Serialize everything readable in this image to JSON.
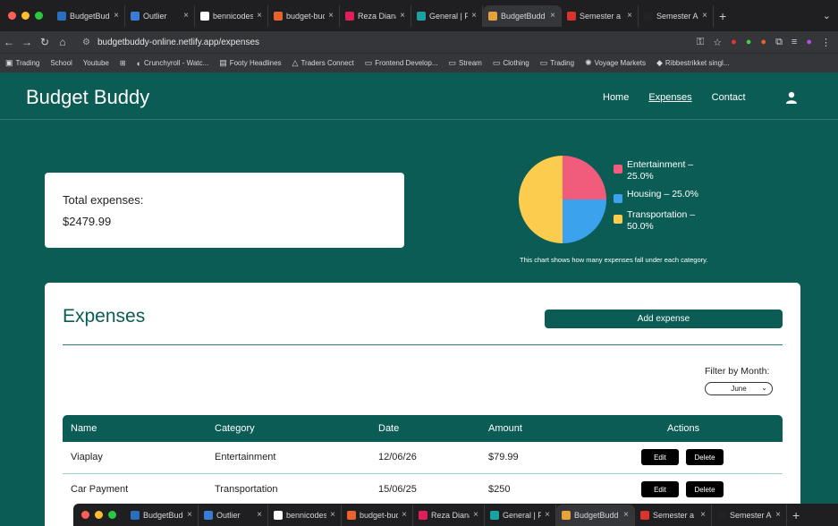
{
  "browser": {
    "tabs": [
      {
        "title": "BudgetBudd",
        "color": "#2a6ebf"
      },
      {
        "title": "Outlier",
        "color": "#3a7bd5"
      },
      {
        "title": "bennicodes",
        "color": "#ffffff"
      },
      {
        "title": "budget-bud",
        "color": "#e8632c"
      },
      {
        "title": "Reza Dianat",
        "color": "#e01e5a"
      },
      {
        "title": "General | P",
        "color": "#1aa1a1"
      },
      {
        "title": "BudgetBudd",
        "color": "#e6a23c",
        "active": true
      },
      {
        "title": "Semester a",
        "color": "#d9342b"
      },
      {
        "title": "Semester A",
        "color": "#222222"
      }
    ],
    "url": "budgetbuddy-online.netlify.app/expenses",
    "bookmarks": [
      "Trading",
      "School",
      "Youtube",
      "Crunchyroll - Watc...",
      "Footy Headlines",
      "Traders Connect",
      "Frontend Develop...",
      "Stream",
      "Clothing",
      "Trading",
      "Voyage Markets",
      "Ribbestrikket singl..."
    ]
  },
  "site": {
    "brand": "Budget Buddy",
    "nav": [
      "Home",
      "Expenses",
      "Contact"
    ]
  },
  "summary": {
    "total_label": "Total expenses:",
    "total_value": "$2479.99"
  },
  "chart_data": {
    "type": "pie",
    "slices": [
      {
        "label": "Entertainment",
        "percent": 25.0,
        "color": "#f25c7c"
      },
      {
        "label": "Housing",
        "percent": 25.0,
        "color": "#3ba3ee"
      },
      {
        "label": "Transportation",
        "percent": 50.0,
        "color": "#fccc4f"
      }
    ],
    "legend_labels": [
      "Entertainment – 25.0%",
      "Housing – 25.0%",
      "Transportation – 50.0%"
    ],
    "caption": "This chart shows how many expenses fall under each category.",
    "legend_position": "right"
  },
  "expenses": {
    "title": "Expenses",
    "add_label": "Add expense",
    "filter_label": "Filter by Month:",
    "filter_value": "June",
    "columns": [
      "Name",
      "Category",
      "Date",
      "Amount",
      "Actions"
    ],
    "rows": [
      {
        "name": "Viaplay",
        "category": "Entertainment",
        "date": "12/06/26",
        "amount": "$79.99"
      },
      {
        "name": "Car Payment",
        "category": "Transportation",
        "date": "15/06/25",
        "amount": "$250"
      }
    ],
    "edit_label": "Edit",
    "delete_label": "Delete"
  }
}
